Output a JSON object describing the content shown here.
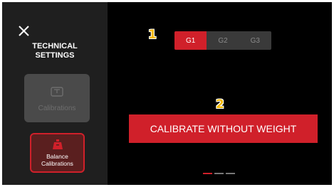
{
  "sidebar": {
    "title": "TECHNICAL\nSETTINGS",
    "items": [
      {
        "label": "Calibrations",
        "icon": "scale-tray-icon"
      },
      {
        "label": "Balance\nCalibrations",
        "icon": "balance-weight-icon"
      }
    ]
  },
  "steps": {
    "one": "1",
    "two": "2"
  },
  "group_selector": {
    "options": [
      "G1",
      "G2",
      "G3"
    ],
    "selected": "G1"
  },
  "main": {
    "calibrate_label": "CALIBRATE WITHOUT WEIGHT"
  },
  "pagination": {
    "pages": 3,
    "current": 1
  },
  "colors": {
    "accent": "#d0202a",
    "sidebar_bg": "#1f1f1f",
    "background": "#000000",
    "step_number": "#f5b800"
  }
}
